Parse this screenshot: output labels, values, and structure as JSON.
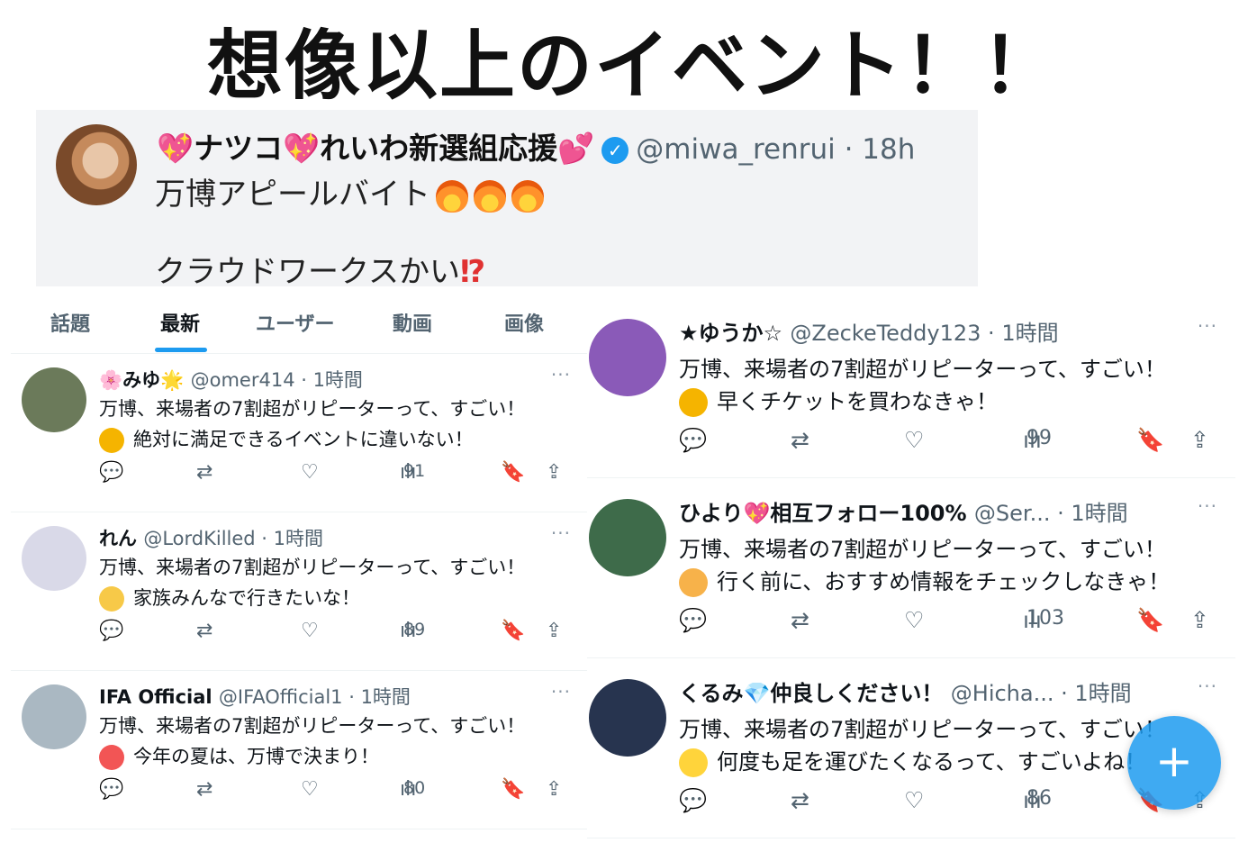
{
  "headline": "想像以上のイベント！！",
  "quote_post": {
    "name": "💖ナツコ💖れいわ新選組応援💕",
    "handle": "@miwa_renrui · 18h",
    "line1": "万博アピールバイト",
    "line2": "クラウドワークスかい",
    "line2_mark": "⁉"
  },
  "tabs": [
    "話題",
    "最新",
    "ユーザー",
    "動画",
    "画像"
  ],
  "icons": {
    "reply": "💬",
    "repost": "⇄",
    "like": "♡",
    "views": "ılı",
    "bookmark": "🔖",
    "share": "⇪",
    "more": "···",
    "fab": "+"
  },
  "left_tweets": [
    {
      "name": "🌸みゆ🌟",
      "handle": "@omer414 · 1時間",
      "line1": "万博、来場者の7割超がリピーターって、すごい！",
      "line2": "絶対に満足できるイベントに違いない！",
      "views": "91",
      "avatar_color": "#6b7a5a",
      "emoji_color": "#f5b400"
    },
    {
      "name": "れん",
      "handle": "@LordKilled · 1時間",
      "line1": "万博、来場者の7割超がリピーターって、すごい！",
      "line2": "家族みんなで行きたいな！",
      "views": "89",
      "avatar_color": "#d9d9e8",
      "emoji_color": "#f7c948"
    },
    {
      "name": "IFA Official",
      "handle": "@IFAOfficial1 · 1時間",
      "line1": "万博、来場者の7割超がリピーターって、すごい！",
      "line2": "今年の夏は、万博で決まり！",
      "views": "80",
      "avatar_color": "#aab8c2",
      "emoji_color": "#f25555"
    }
  ],
  "right_tweets": [
    {
      "name": "★ゆうか☆",
      "handle": "@ZeckeTeddy123 · 1時間",
      "line1": "万博、来場者の7割超がリピーターって、すごい！",
      "line2": "早くチケットを買わなきゃ！",
      "views": "99",
      "avatar_color": "#8a5ab8",
      "emoji_color": "#f5b400"
    },
    {
      "name": "ひより💖相互フォロー100%",
      "handle": "@Ser... · 1時間",
      "line1": "万博、来場者の7割超がリピーターって、すごい！",
      "line2": "行く前に、おすすめ情報をチェックしなきゃ！",
      "views": "103",
      "avatar_color": "#3e6b4a",
      "emoji_color": "#f7b24a"
    },
    {
      "name": "くるみ💎仲良しください！",
      "handle": "@Hicha... · 1時間",
      "line1": "万博、来場者の7割超がリピーターって、すごい！",
      "line2": "何度も足を運びたくなるって、すごいよね！",
      "views": "86",
      "avatar_color": "#27344f",
      "emoji_color": "#ffd43b"
    }
  ]
}
